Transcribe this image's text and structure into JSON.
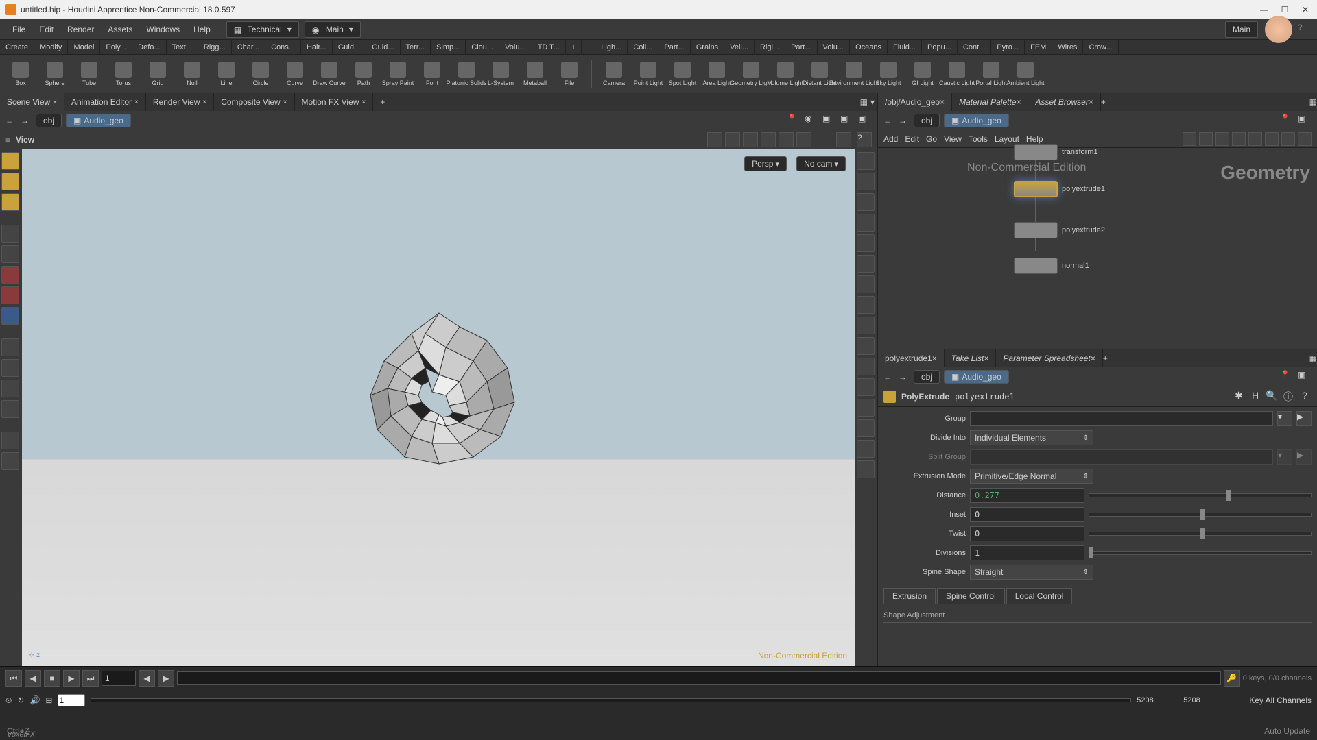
{
  "window": {
    "title": "untitled.hip - Houdini Apprentice Non-Commercial 18.0.597",
    "ctrl_z": "Ctrl+Z",
    "voxelfx": "VoxelFX"
  },
  "menubar": {
    "items": [
      "File",
      "Edit",
      "Render",
      "Assets",
      "Windows",
      "Help"
    ],
    "desktop": "Technical",
    "radial": "Main",
    "panemenu": "Main"
  },
  "shelf_tabs_left": [
    "Create",
    "Modify",
    "Model",
    "Poly...",
    "Defo...",
    "Text...",
    "Rigg...",
    "Char...",
    "Cons...",
    "Hair...",
    "Guid...",
    "Guid...",
    "Terr...",
    "Simp...",
    "Clou...",
    "Volu...",
    "TD T..."
  ],
  "shelf_tabs_right": [
    "Ligh...",
    "Coll...",
    "Part...",
    "Grains",
    "Vell...",
    "Rigi...",
    "Part...",
    "Volu...",
    "Oceans",
    "Fluid...",
    "Popu...",
    "Cont...",
    "Pyro...",
    "FEM",
    "Wires",
    "Crow..."
  ],
  "shelf_tools_left": [
    "Box",
    "Sphere",
    "Tube",
    "Torus",
    "Grid",
    "Null",
    "Line",
    "Circle",
    "Curve",
    "Draw Curve",
    "Path",
    "Spray Paint",
    "Font",
    "Platonic Solids",
    "L-System",
    "Metaball",
    "File"
  ],
  "shelf_tools_right": [
    "Camera",
    "Point Light",
    "Spot Light",
    "Area Light",
    "Geometry Light",
    "Volume Light",
    "Distant Light",
    "Environment Light",
    "Sky Light",
    "GI Light",
    "Caustic Light",
    "Portal Light",
    "Ambient Light"
  ],
  "left_tabs": [
    "Scene View",
    "Animation Editor",
    "Render View",
    "Composite View",
    "Motion FX View"
  ],
  "path": {
    "root": "obj",
    "node": "Audio_geo"
  },
  "view": {
    "label": "View",
    "persp": "Persp",
    "cam": "No cam",
    "watermark": "Non-Commercial Edition"
  },
  "right_top_tabs": [
    "/obj/Audio_geo",
    "Material Palette",
    "Asset Browser"
  ],
  "node_menu": [
    "Add",
    "Edit",
    "Go",
    "View",
    "Tools",
    "Layout",
    "Help"
  ],
  "graph": {
    "watermark1": "Non-Commercial Edition",
    "watermark2": "Geometry",
    "nodes": [
      {
        "name": "transform1",
        "sel": false
      },
      {
        "name": "polyextrude1",
        "sel": true
      },
      {
        "name": "polyextrude2",
        "sel": false
      },
      {
        "name": "normal1",
        "sel": false
      }
    ]
  },
  "param_tabs": [
    "polyextrude1",
    "Take List",
    "Parameter Spreadsheet"
  ],
  "param_header": {
    "type": "PolyExtrude",
    "name": "polyextrude1"
  },
  "params": {
    "group_label": "Group",
    "group_val": "",
    "divide_label": "Divide Into",
    "divide_val": "Individual Elements",
    "split_label": "Split Group",
    "split_val": "",
    "mode_label": "Extrusion Mode",
    "mode_val": "Primitive/Edge Normal",
    "dist_label": "Distance",
    "dist_val": "0.277",
    "inset_label": "Inset",
    "inset_val": "0",
    "twist_label": "Twist",
    "twist_val": "0",
    "div_label": "Divisions",
    "div_val": "1",
    "spine_label": "Spine Shape",
    "spine_val": "Straight",
    "subtabs": [
      "Extrusion",
      "Spine Control",
      "Local Control"
    ],
    "section": "Shape Adjustment"
  },
  "timeline": {
    "frame": "1",
    "start": "1",
    "end": "5208",
    "end2": "5208",
    "keys": "0 keys, 0/0 channels",
    "keyall": "Key All Channels",
    "auto": "Auto Update"
  }
}
